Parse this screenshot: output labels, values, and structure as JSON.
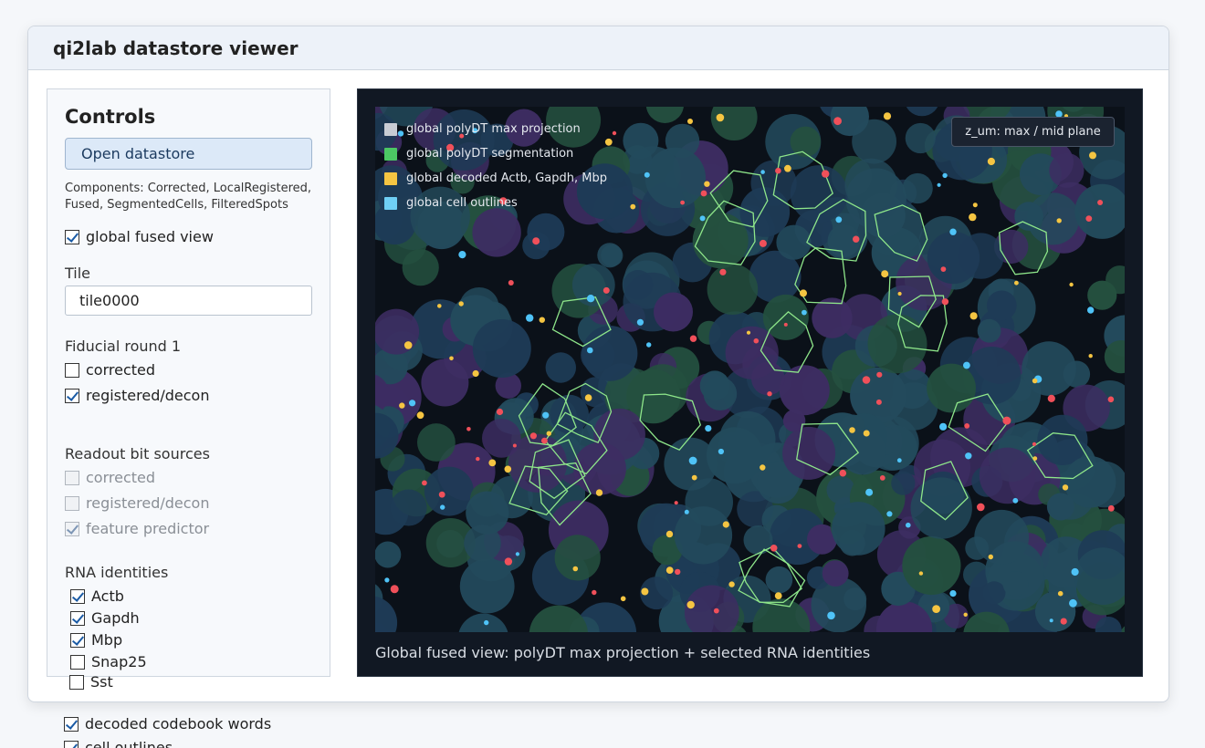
{
  "window": {
    "title": "qi2lab datastore viewer"
  },
  "controls": {
    "heading": "Controls",
    "open_button": "Open datastore",
    "components_text": "Components: Corrected, LocalRegistered, Fused, SegmentedCells, FilteredSpots",
    "global_fused_view": {
      "label": "global fused view",
      "checked": true
    },
    "tile": {
      "label": "Tile",
      "value": "tile0000"
    },
    "fiducial": {
      "label": "Fiducial round 1",
      "options": [
        {
          "label": "corrected",
          "checked": false
        },
        {
          "label": "registered/decon",
          "checked": true
        }
      ]
    },
    "readout": {
      "label": "Readout bit sources",
      "options": [
        {
          "label": "corrected",
          "checked": false
        },
        {
          "label": "registered/decon",
          "checked": false
        },
        {
          "label": "feature predictor",
          "checked": true
        }
      ]
    },
    "rna": {
      "label": "RNA identities",
      "options": [
        {
          "label": "Actb",
          "checked": true
        },
        {
          "label": "Gapdh",
          "checked": true
        },
        {
          "label": "Mbp",
          "checked": true
        },
        {
          "label": "Snap25",
          "checked": false
        },
        {
          "label": "Sst",
          "checked": false
        }
      ]
    },
    "overflow": [
      {
        "label": "decoded codebook words",
        "checked": true
      },
      {
        "label": "cell outlines",
        "checked": true
      }
    ]
  },
  "viewer": {
    "legend": [
      {
        "label": "global polyDT max projection",
        "color": "#c8ccd4"
      },
      {
        "label": "global polyDT segmentation",
        "color": "#4cc764"
      },
      {
        "label": "global decoded Actb, Gapdh, Mbp",
        "color": "#f5c542"
      },
      {
        "label": "global cell outlines",
        "color": "#6fcff5"
      }
    ],
    "z_badge": "z_um: max / mid plane",
    "caption": "Global fused view: polyDT max projection + selected RNA identities",
    "colors": {
      "cell_purple": "#3d2d62",
      "cell_teal": "#234a5c",
      "cell_green": "#24503f",
      "cell_navy": "#1e3b56",
      "outline": "#8ee68a",
      "spot_red": "#f0505a",
      "spot_yellow": "#f5c542",
      "spot_cyan": "#4fc3f7"
    }
  }
}
